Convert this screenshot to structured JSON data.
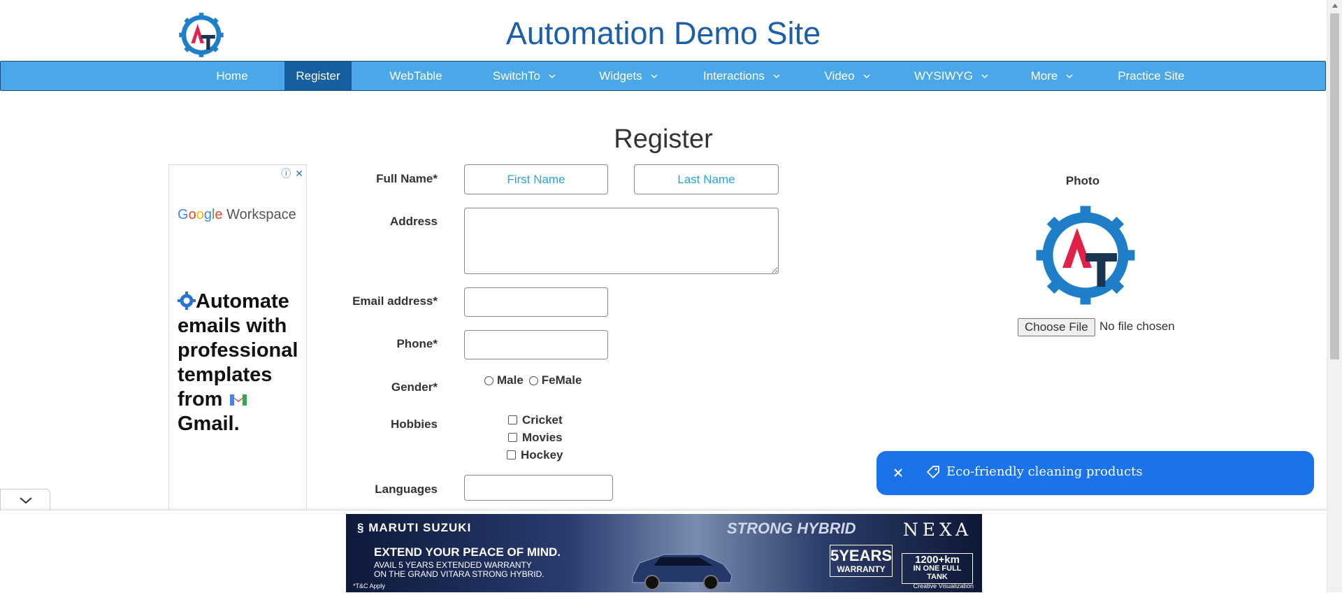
{
  "site": {
    "title": "Automation Demo Site"
  },
  "nav": {
    "items": [
      {
        "label": "Home"
      },
      {
        "label": "Register"
      },
      {
        "label": "WebTable"
      },
      {
        "label": "SwitchTo"
      },
      {
        "label": "Widgets"
      },
      {
        "label": "Interactions"
      },
      {
        "label": "Video"
      },
      {
        "label": "WYSIWYG"
      },
      {
        "label": "More"
      },
      {
        "label": "Practice Site"
      }
    ],
    "active": "Register"
  },
  "page": {
    "heading": "Register"
  },
  "form": {
    "full_name_label": "Full Name*",
    "first_name_placeholder": "First Name",
    "last_name_placeholder": "Last Name",
    "address_label": "Address",
    "email_label": "Email address*",
    "phone_label": "Phone*",
    "gender_label": "Gender*",
    "gender_options": [
      "Male",
      "FeMale"
    ],
    "hobbies_label": "Hobbies",
    "hobbies": [
      "Cricket",
      "Movies",
      "Hockey"
    ],
    "languages_label": "Languages"
  },
  "photo": {
    "label": "Photo",
    "choose_button": "Choose File",
    "status": "No file chosen"
  },
  "ad_left": {
    "brand_google": [
      "G",
      "o",
      "o",
      "g",
      "l",
      "e"
    ],
    "brand_suffix": " Workspace",
    "copy_line": "Automate emails with professional templates from",
    "copy_brand": "Gmail."
  },
  "toast": {
    "text": "Eco-friendly cleaning products"
  },
  "banner": {
    "brand": "MARUTI SUZUKI",
    "headline": "EXTEND YOUR PEACE OF MIND.",
    "sub1": "AVAIL 5 YEARS EXTENDED WARRANTY",
    "sub2": "ON THE GRAND VITARA STRONG HYBRID.",
    "hybrid": "STRONG HYBRID",
    "nexa": "NEXA",
    "years_big": "5YEARS",
    "years_small": "WARRANTY",
    "km_big": "1200+km",
    "km_small": "IN ONE FULL TANK",
    "tc": "*T&C Apply",
    "credit": "Creative Visualization"
  },
  "colors": {
    "nav_bg": "#4aa8e8",
    "nav_active": "#155ea0",
    "title": "#1a5fa8",
    "toast": "#1a73e8",
    "placeholder": "#29a3e0"
  }
}
